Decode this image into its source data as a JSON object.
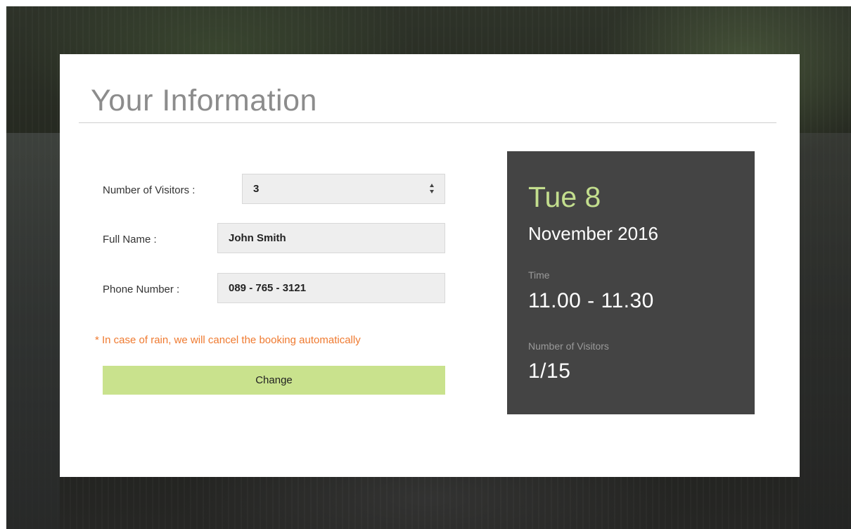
{
  "page": {
    "title": "Your Information"
  },
  "form": {
    "visitors_label": "Number of Visitors :",
    "visitors_value": "3",
    "name_label": "Full Name :",
    "name_value": "John Smith",
    "phone_label": "Phone Number :",
    "phone_value": "089 - 765 - 3121",
    "rain_note": "* In case of rain, we will cancel the booking automatically",
    "change_label": "Change"
  },
  "summary": {
    "day": "Tue 8",
    "month_year": "November 2016",
    "time_label": "Time",
    "time_value": "11.00 - 11.30",
    "visitors_label": "Number of Visitors",
    "visitors_value": "1/15"
  },
  "colors": {
    "accent_green": "#c3de8e",
    "button_green": "#c9e28d",
    "warning_orange": "#ef7a30",
    "summary_bg": "#444444"
  }
}
